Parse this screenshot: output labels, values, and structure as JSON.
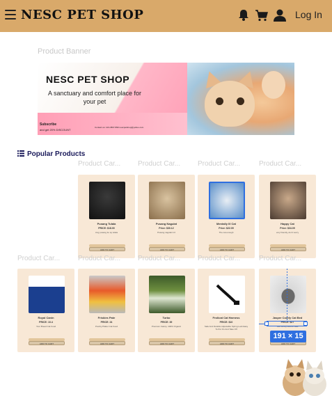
{
  "header": {
    "brand": "NESC PET SHOP",
    "login_label": "Log In"
  },
  "icons": {
    "menu": "hamburger-menu-icon",
    "bell": "bell-icon",
    "cart": "cart-icon",
    "user": "user-icon"
  },
  "banner": {
    "label": "Product Banner",
    "title": "NESC PET SHOP",
    "tagline": "A sanctuary and comfort place for your pet",
    "subscribe": "Subscribe",
    "subscribe_note": "and get 20% DISCOUNT",
    "contact": "Contact us: 123-4567-890 nescpetshop@yahoo.com"
  },
  "popular": {
    "title": "Popular Products",
    "row1": [
      {
        "label": "Product Car...",
        "name": "Pusang Tulala",
        "price": "PRICE: $18.00",
        "desc": "Ang pusang ito ay tulala"
      },
      {
        "label": "Product Car...",
        "name": "Pusang Nagulat",
        "price": "Price: $30.12",
        "desc": "Pusang nagulat 4.0"
      },
      {
        "label": "Product Car...",
        "name": "Mentally Ill Cat",
        "price": "Price: $22.09",
        "desc": "The cat enough"
      },
      {
        "label": "Product Car...",
        "name": "Happy Cat",
        "price": "Price: $34.09",
        "desc": "very friendly, don't worry"
      }
    ],
    "row2": [
      {
        "label": "Product Car...",
        "name": "Royal Canin",
        "price": "PRICE: 10.4",
        "desc": "Your Breed Cat Food"
      },
      {
        "label": "Product Car...",
        "name": "Friskies Pate",
        "price": "PRICE: 24",
        "desc": "Poultry Platter Cat Food"
      },
      {
        "label": "Product Car...",
        "name": "Turbo",
        "price": "PRICE: 39",
        "desc": "Premium Catnip, 100% Organic"
      },
      {
        "label": "Product Car...",
        "name": "Frolicat Cat Harness",
        "price": "PRICE: $10",
        "desc": "Safe And Durable Adjustable Spring Lock Easy To Put On And Take Off"
      },
      {
        "label": "Product Car...",
        "name": "Jasper Comfy Cat Bed",
        "price": "PRICE: $27",
        "desc": "Soft comfy bed for cats"
      }
    ],
    "button_label": "ADD TO CART"
  },
  "overlay": {
    "measure": "191 × 15"
  }
}
